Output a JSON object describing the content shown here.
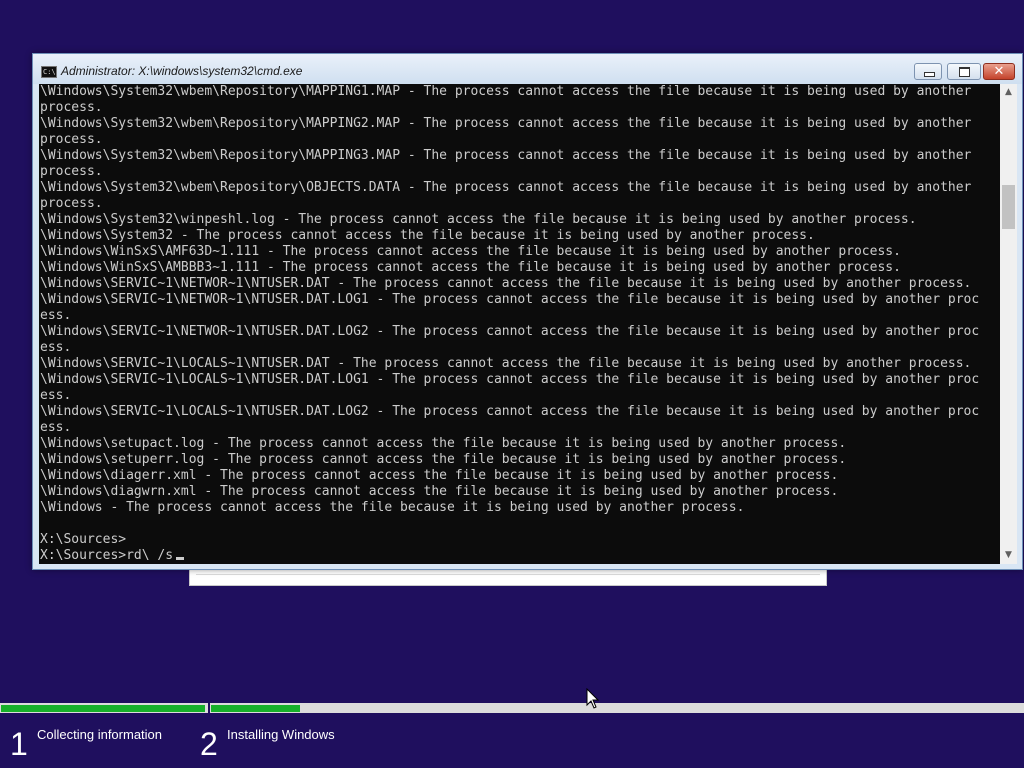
{
  "colors": {
    "desktop_background": "#1f0f5e",
    "console_background": "#0c0c0c",
    "console_text": "#cccccc",
    "progress_fill": "#17b12a"
  },
  "window": {
    "title": "Administrator: X:\\windows\\system32\\cmd.exe",
    "icon": "cmd-icon",
    "icon_text": "C:\\",
    "controls": {
      "minimize": "minimize-icon",
      "maximize": "maximize-icon",
      "close_glyph": "✕"
    }
  },
  "console": {
    "lines": [
      "\\Windows\\System32\\wbem\\Repository\\MAPPING1.MAP - The process cannot access the file because it is being used by another",
      "process.",
      "\\Windows\\System32\\wbem\\Repository\\MAPPING2.MAP - The process cannot access the file because it is being used by another",
      "process.",
      "\\Windows\\System32\\wbem\\Repository\\MAPPING3.MAP - The process cannot access the file because it is being used by another",
      "process.",
      "\\Windows\\System32\\wbem\\Repository\\OBJECTS.DATA - The process cannot access the file because it is being used by another",
      "process.",
      "\\Windows\\System32\\winpeshl.log - The process cannot access the file because it is being used by another process.",
      "\\Windows\\System32 - The process cannot access the file because it is being used by another process.",
      "\\Windows\\WinSxS\\AMF63D~1.111 - The process cannot access the file because it is being used by another process.",
      "\\Windows\\WinSxS\\AMBBB3~1.111 - The process cannot access the file because it is being used by another process.",
      "\\Windows\\SERVIC~1\\NETWOR~1\\NTUSER.DAT - The process cannot access the file because it is being used by another process.",
      "\\Windows\\SERVIC~1\\NETWOR~1\\NTUSER.DAT.LOG1 - The process cannot access the file because it is being used by another proc",
      "ess.",
      "\\Windows\\SERVIC~1\\NETWOR~1\\NTUSER.DAT.LOG2 - The process cannot access the file because it is being used by another proc",
      "ess.",
      "\\Windows\\SERVIC~1\\LOCALS~1\\NTUSER.DAT - The process cannot access the file because it is being used by another process.",
      "\\Windows\\SERVIC~1\\LOCALS~1\\NTUSER.DAT.LOG1 - The process cannot access the file because it is being used by another proc",
      "ess.",
      "\\Windows\\SERVIC~1\\LOCALS~1\\NTUSER.DAT.LOG2 - The process cannot access the file because it is being used by another proc",
      "ess.",
      "\\Windows\\setupact.log - The process cannot access the file because it is being used by another process.",
      "\\Windows\\setuperr.log - The process cannot access the file because it is being used by another process.",
      "\\Windows\\diagerr.xml - The process cannot access the file because it is being used by another process.",
      "\\Windows\\diagwrn.xml - The process cannot access the file because it is being used by another process.",
      "\\Windows - The process cannot access the file because it is being used by another process.",
      "",
      "X:\\Sources>"
    ],
    "prompt_line": "X:\\Sources>rd\\ /s"
  },
  "scrollbar": {
    "up_glyph": "▲",
    "down_glyph": "▼",
    "position": 0.21
  },
  "setup": {
    "progress": [
      {
        "step": 1,
        "fill": 0.99
      },
      {
        "step": 2,
        "fill": 0.11
      }
    ],
    "steps": [
      {
        "number": "1",
        "label": "Collecting information"
      },
      {
        "number": "2",
        "label": "Installing Windows"
      }
    ]
  }
}
